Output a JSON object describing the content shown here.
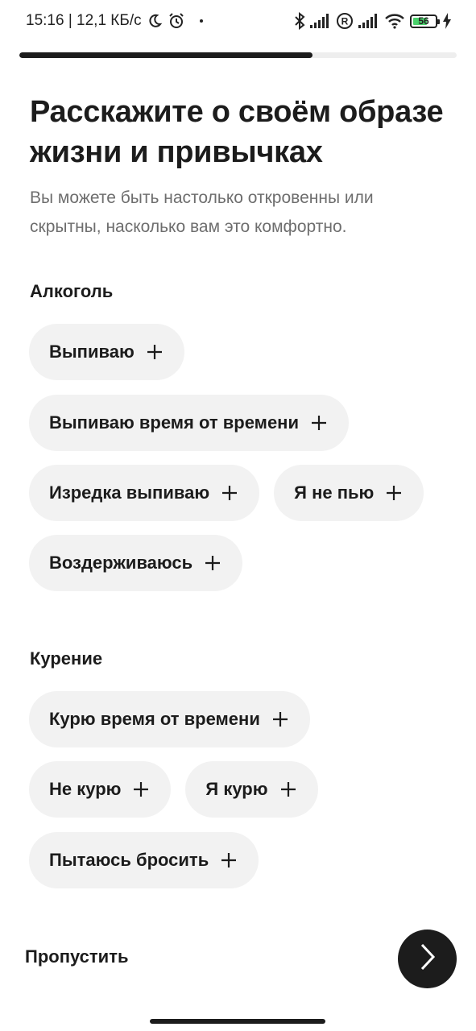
{
  "status_bar": {
    "time_speed": "15:16 | 12,1 КБ/с",
    "battery": "56",
    "icons": [
      "moon-icon",
      "alarm-icon",
      "bluetooth-icon",
      "signal-icon",
      "roaming-icon",
      "signal-icon",
      "wifi-icon",
      "battery-icon",
      "charging-icon"
    ]
  },
  "progress": {
    "value": 0.67
  },
  "header": {
    "title": "Расскажите о своём образе жизни и привычках",
    "subtitle": "Вы можете быть настолько откровенны или скрытны, насколько вам это комфортно."
  },
  "sections": {
    "alcohol": {
      "title": "Алкоголь",
      "options": [
        "Выпиваю",
        "Выпиваю время от времени",
        "Изредка выпиваю",
        "Я не пью",
        "Воздерживаюсь"
      ]
    },
    "smoking": {
      "title": "Курение",
      "options": [
        "Курю время от времени",
        "Не курю",
        "Я курю",
        "Пытаюсь бросить"
      ]
    }
  },
  "footer": {
    "skip_label": "Пропустить",
    "next_icon": "chevron-right-icon"
  },
  "colors": {
    "primary": "#1c1c1c",
    "chip_bg": "#f2f2f2",
    "muted_text": "#6e6e6e",
    "progress_track": "#eeeeee"
  }
}
